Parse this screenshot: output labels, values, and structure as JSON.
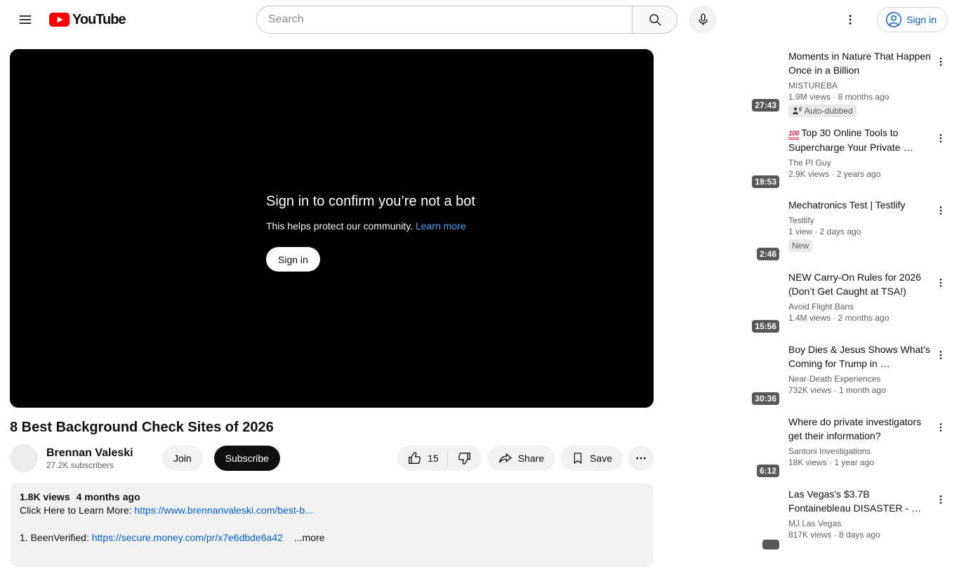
{
  "header": {
    "logo_label": "YouTube",
    "search_placeholder": "Search",
    "sign_in_label": "Sign in"
  },
  "player": {
    "overlay": {
      "title": "Sign in to confirm you’re not a bot",
      "subtitle": "This helps protect our community. ",
      "learn_more_label": "Learn more",
      "sign_in_label": "Sign in"
    }
  },
  "video": {
    "title": "8 Best Background Check Sites of 2026",
    "channel": {
      "name": "Brennan Valeski",
      "subscribers": "27.2K subscribers"
    },
    "buttons": {
      "join": "Join",
      "subscribe": "Subscribe",
      "like_count": "15",
      "share": "Share",
      "save": "Save"
    }
  },
  "description": {
    "views": "1.8K views",
    "age": "4 months ago",
    "line1_label": "Click Here to Learn More: ",
    "line1_url": "https://www.brennanvaleski.com/best-b...",
    "line2_label": "1. BeenVerified: ",
    "line2_url": "https://secure.money.com/pr/x7e6dbde6a42",
    "more_label": "...more"
  },
  "colors": {
    "brand_red": "#ff0000",
    "link_blue": "#065fd4",
    "player_link_blue": "#3ea6ff",
    "duration_badge_bg": "#585858"
  },
  "sidebar": {
    "items": [
      {
        "title": "Moments in Nature That Happen Once in a Billion",
        "channel": "MISTUREBA",
        "meta": "1.9M views · 8 months ago",
        "duration": "27:43",
        "badge": "Auto-dubbed"
      },
      {
        "emoji": "💯",
        "title": "Top 30 Online Tools to Supercharge Your Private …",
        "channel": "The PI Guy",
        "meta": "2.9K views · 2 years ago",
        "duration": "19:53"
      },
      {
        "title": "Mechatronics Test | Testlify",
        "channel": "Testlify",
        "meta": "1 view · 2 days ago",
        "duration": "2:46",
        "badge": "New"
      },
      {
        "title": "NEW Carry-On Rules for 2026 (Don’t Get Caught at TSA!)",
        "channel": "Avoid Flight Bans",
        "meta": "1.4M views · 2 months ago",
        "duration": "15:56"
      },
      {
        "title": "Boy Dies & Jesus Shows What’s Coming for Trump in …",
        "channel": "Near-Death Experiences",
        "meta": "732K views · 1 month ago",
        "duration": "30:36"
      },
      {
        "title": "Where do private investigators get their information?",
        "channel": "Santoni Investigations",
        "meta": "18K views · 1 year ago",
        "duration": "6:12"
      },
      {
        "title": "Las Vegas's $3.7B Fontainebleau DISASTER  - …",
        "channel": "MJ Las Vegas",
        "meta": "817K views · 8 days ago",
        "duration": ""
      }
    ]
  }
}
